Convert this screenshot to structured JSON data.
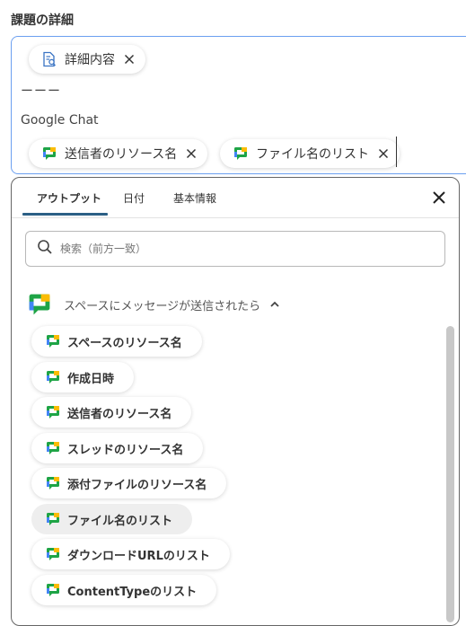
{
  "section_title": "課題の詳細",
  "editor": {
    "top_chip": "詳細内容",
    "separator": "ーーー",
    "service_label": "Google Chat",
    "chips": [
      "送信者のリソース名",
      "ファイル名のリスト"
    ]
  },
  "popup": {
    "tabs": [
      "アウトプット",
      "日付",
      "基本情報"
    ],
    "active_tab": "アウトプット",
    "search_placeholder": "検索（前方一致）",
    "group_title": "スペースにメッセージが送信されたら",
    "items": [
      "スペースのリソース名",
      "作成日時",
      "送信者のリソース名",
      "スレッドのリソース名",
      "添付ファイルのリソース名",
      "ファイル名のリスト",
      "ダウンロードURLのリスト",
      "ContentTypeのリスト"
    ]
  },
  "icons": {
    "chip_doc": "document-search-icon",
    "chip_close": "close-icon",
    "google_chat": "google-chat-icon",
    "search": "search-icon",
    "collapse": "chevron-up-icon",
    "popup_close": "close-icon"
  },
  "colors": {
    "focus_border": "#6b9ff0",
    "tab_underline": "#2b5f85",
    "gchat_green": "#1ea446",
    "gchat_yellow": "#fbbc04",
    "gchat_blue": "#4285f4"
  }
}
